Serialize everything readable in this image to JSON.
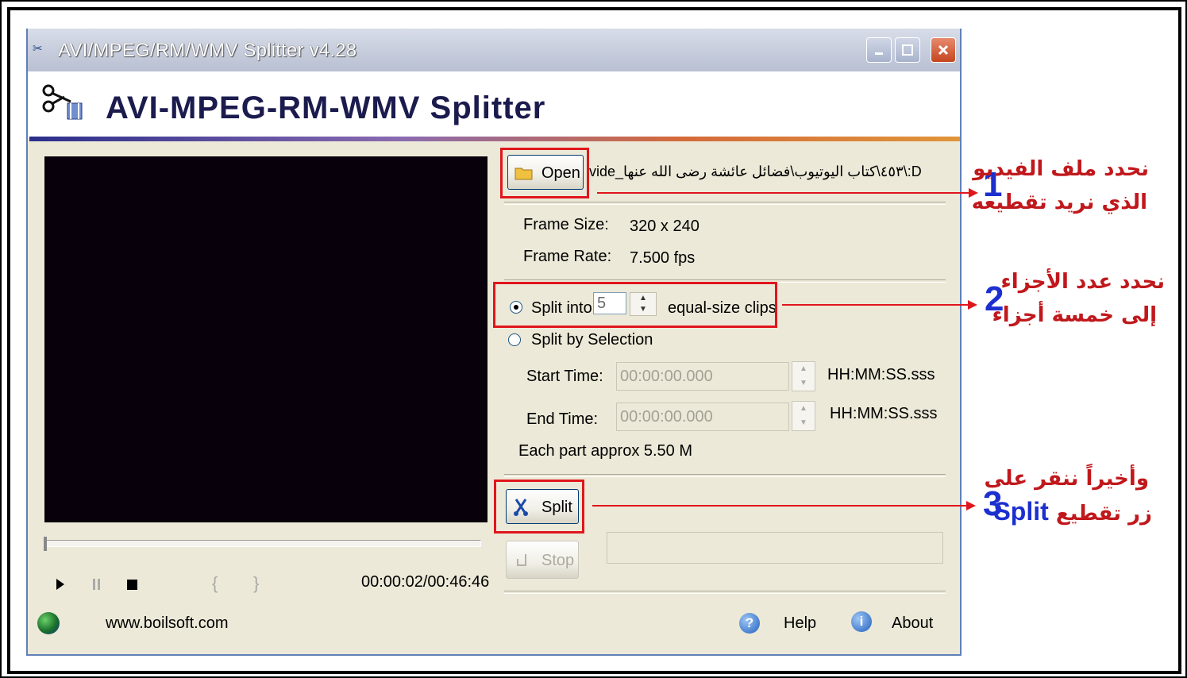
{
  "window": {
    "title": "AVI/MPEG/RM/WMV Splitter v4.28",
    "banner_title": "AVI-MPEG-RM-WMV Splitter"
  },
  "file": {
    "open_label": "Open",
    "path": "D:\\٤٥٣\\كتاب اليوتيوب\\فضائل عائشة رضى الله عنها_vide"
  },
  "info": {
    "frame_size_label": "Frame Size:",
    "frame_size_value": "320 x 240",
    "frame_rate_label": "Frame Rate:",
    "frame_rate_value": "7.500 fps"
  },
  "split": {
    "split_into_label": "Split into",
    "split_into_value": "5",
    "equal_size_label": "equal-size clips",
    "split_by_selection_label": "Split by Selection",
    "start_time_label": "Start Time:",
    "start_time_value": "00:00:00.000",
    "end_time_label": "End Time:",
    "end_time_value": "00:00:00.000",
    "time_format": "HH:MM:SS.sss",
    "each_part": "Each part approx 5.50 M",
    "split_button": "Split",
    "stop_button": "Stop"
  },
  "player": {
    "time": "00:00:02/00:46:46",
    "play_icon": "play-icon",
    "pause_icon": "pause-icon",
    "stop_icon": "stop-icon",
    "mark_in": "{",
    "mark_out": "}"
  },
  "footer": {
    "website": "www.boilsoft.com",
    "help_label": "Help",
    "about_label": "About"
  },
  "annotations": [
    {
      "number": "1",
      "line1": "نحدد ملف الفيديو",
      "line2": "الذي نريد تقطيعه"
    },
    {
      "number": "2",
      "line1": "نحدد عدد الأجزاء",
      "line2": "إلى خمسة أجزاء"
    },
    {
      "number": "3",
      "line1": "وأخيراً ننقر على",
      "line2_prefix": "زر تقطيع",
      "line2_word": "Split"
    }
  ],
  "colors": {
    "annotation_red": "#e0161c",
    "annotation_blue": "#1c2fcf",
    "arabic_text": "#c0181c",
    "window_bg": "#ece9d8"
  }
}
